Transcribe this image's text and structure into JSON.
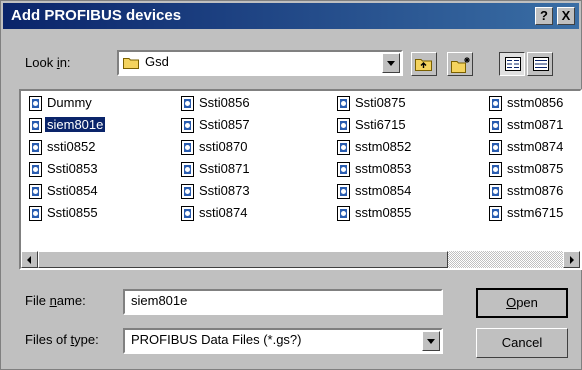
{
  "window": {
    "title": "Add PROFIBUS devices",
    "help_label": "?",
    "close_label": "X"
  },
  "lookin": {
    "label_pre": "Look ",
    "label_u": "i",
    "label_post": "n:",
    "folder": "Gsd",
    "folder_icon": "folder-icon"
  },
  "toolbar": {
    "up_icon": "up-folder-icon",
    "new_icon": "new-folder-icon",
    "list_icon": "list-view-icon",
    "details_icon": "details-view-icon"
  },
  "files": {
    "columns": [
      [
        "Dummy",
        "siem801e",
        "ssti0852",
        "Ssti0853",
        "Ssti0854",
        "Ssti0855"
      ],
      [
        "Ssti0856",
        "Ssti0857",
        "ssti0870",
        "Ssti0871",
        "Ssti0873",
        "ssti0874"
      ],
      [
        "Ssti0875",
        "Ssti6715",
        "sstm0852",
        "sstm0853",
        "sstm0854",
        "sstm0855"
      ],
      [
        "sstm0856",
        "sstm0871",
        "sstm0874",
        "sstm0875",
        "sstm0876",
        "sstm6715"
      ]
    ],
    "selected": "siem801e"
  },
  "filename": {
    "label_pre": "File ",
    "label_u": "n",
    "label_post": "ame:",
    "value": "siem801e"
  },
  "filetype": {
    "label_pre": "Files of ",
    "label_u": "t",
    "label_post": "ype:",
    "value": "PROFIBUS Data Files (*.gs?)"
  },
  "buttons": {
    "open_u": "O",
    "open_rest": "pen",
    "cancel": "Cancel"
  }
}
